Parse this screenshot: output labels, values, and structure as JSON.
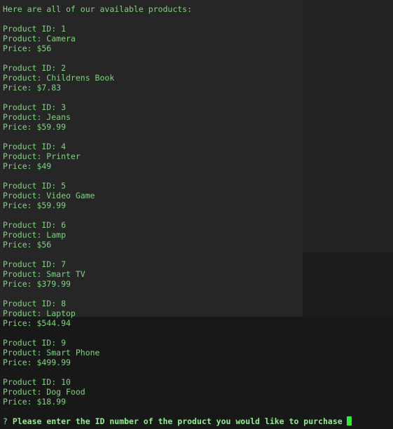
{
  "terminal": {
    "header": "Here are all of our available products:",
    "products": [
      {
        "id_line": "Product ID: 1",
        "name_line": "Product: Camera",
        "price_line": "Price: $56"
      },
      {
        "id_line": "Product ID: 2",
        "name_line": "Product: Childrens Book",
        "price_line": "Price: $7.83"
      },
      {
        "id_line": "Product ID: 3",
        "name_line": "Product: Jeans",
        "price_line": "Price: $59.99"
      },
      {
        "id_line": "Product ID: 4",
        "name_line": "Product: Printer",
        "price_line": "Price: $49"
      },
      {
        "id_line": "Product ID: 5",
        "name_line": "Product: Video Game",
        "price_line": "Price: $59.99"
      },
      {
        "id_line": "Product ID: 6",
        "name_line": "Product: Lamp",
        "price_line": "Price: $56"
      },
      {
        "id_line": "Product ID: 7",
        "name_line": "Product: Smart TV",
        "price_line": "Price: $379.99"
      },
      {
        "id_line": "Product ID: 8",
        "name_line": "Product: Laptop",
        "price_line": "Price: $544.94"
      },
      {
        "id_line": "Product ID: 9",
        "name_line": "Product: Smart Phone",
        "price_line": "Price: $499.99"
      },
      {
        "id_line": "Product ID: 10",
        "name_line": "Product: Dog Food",
        "price_line": "Price: $18.99"
      }
    ],
    "prompt_marker": "?",
    "prompt_text": "Please enter the ID number of the product you would like to purchase"
  },
  "colors": {
    "text": "#7fd47f",
    "prompt": "#8ff08f",
    "cursor": "#2ef02e",
    "background": "#1c1c1c"
  }
}
